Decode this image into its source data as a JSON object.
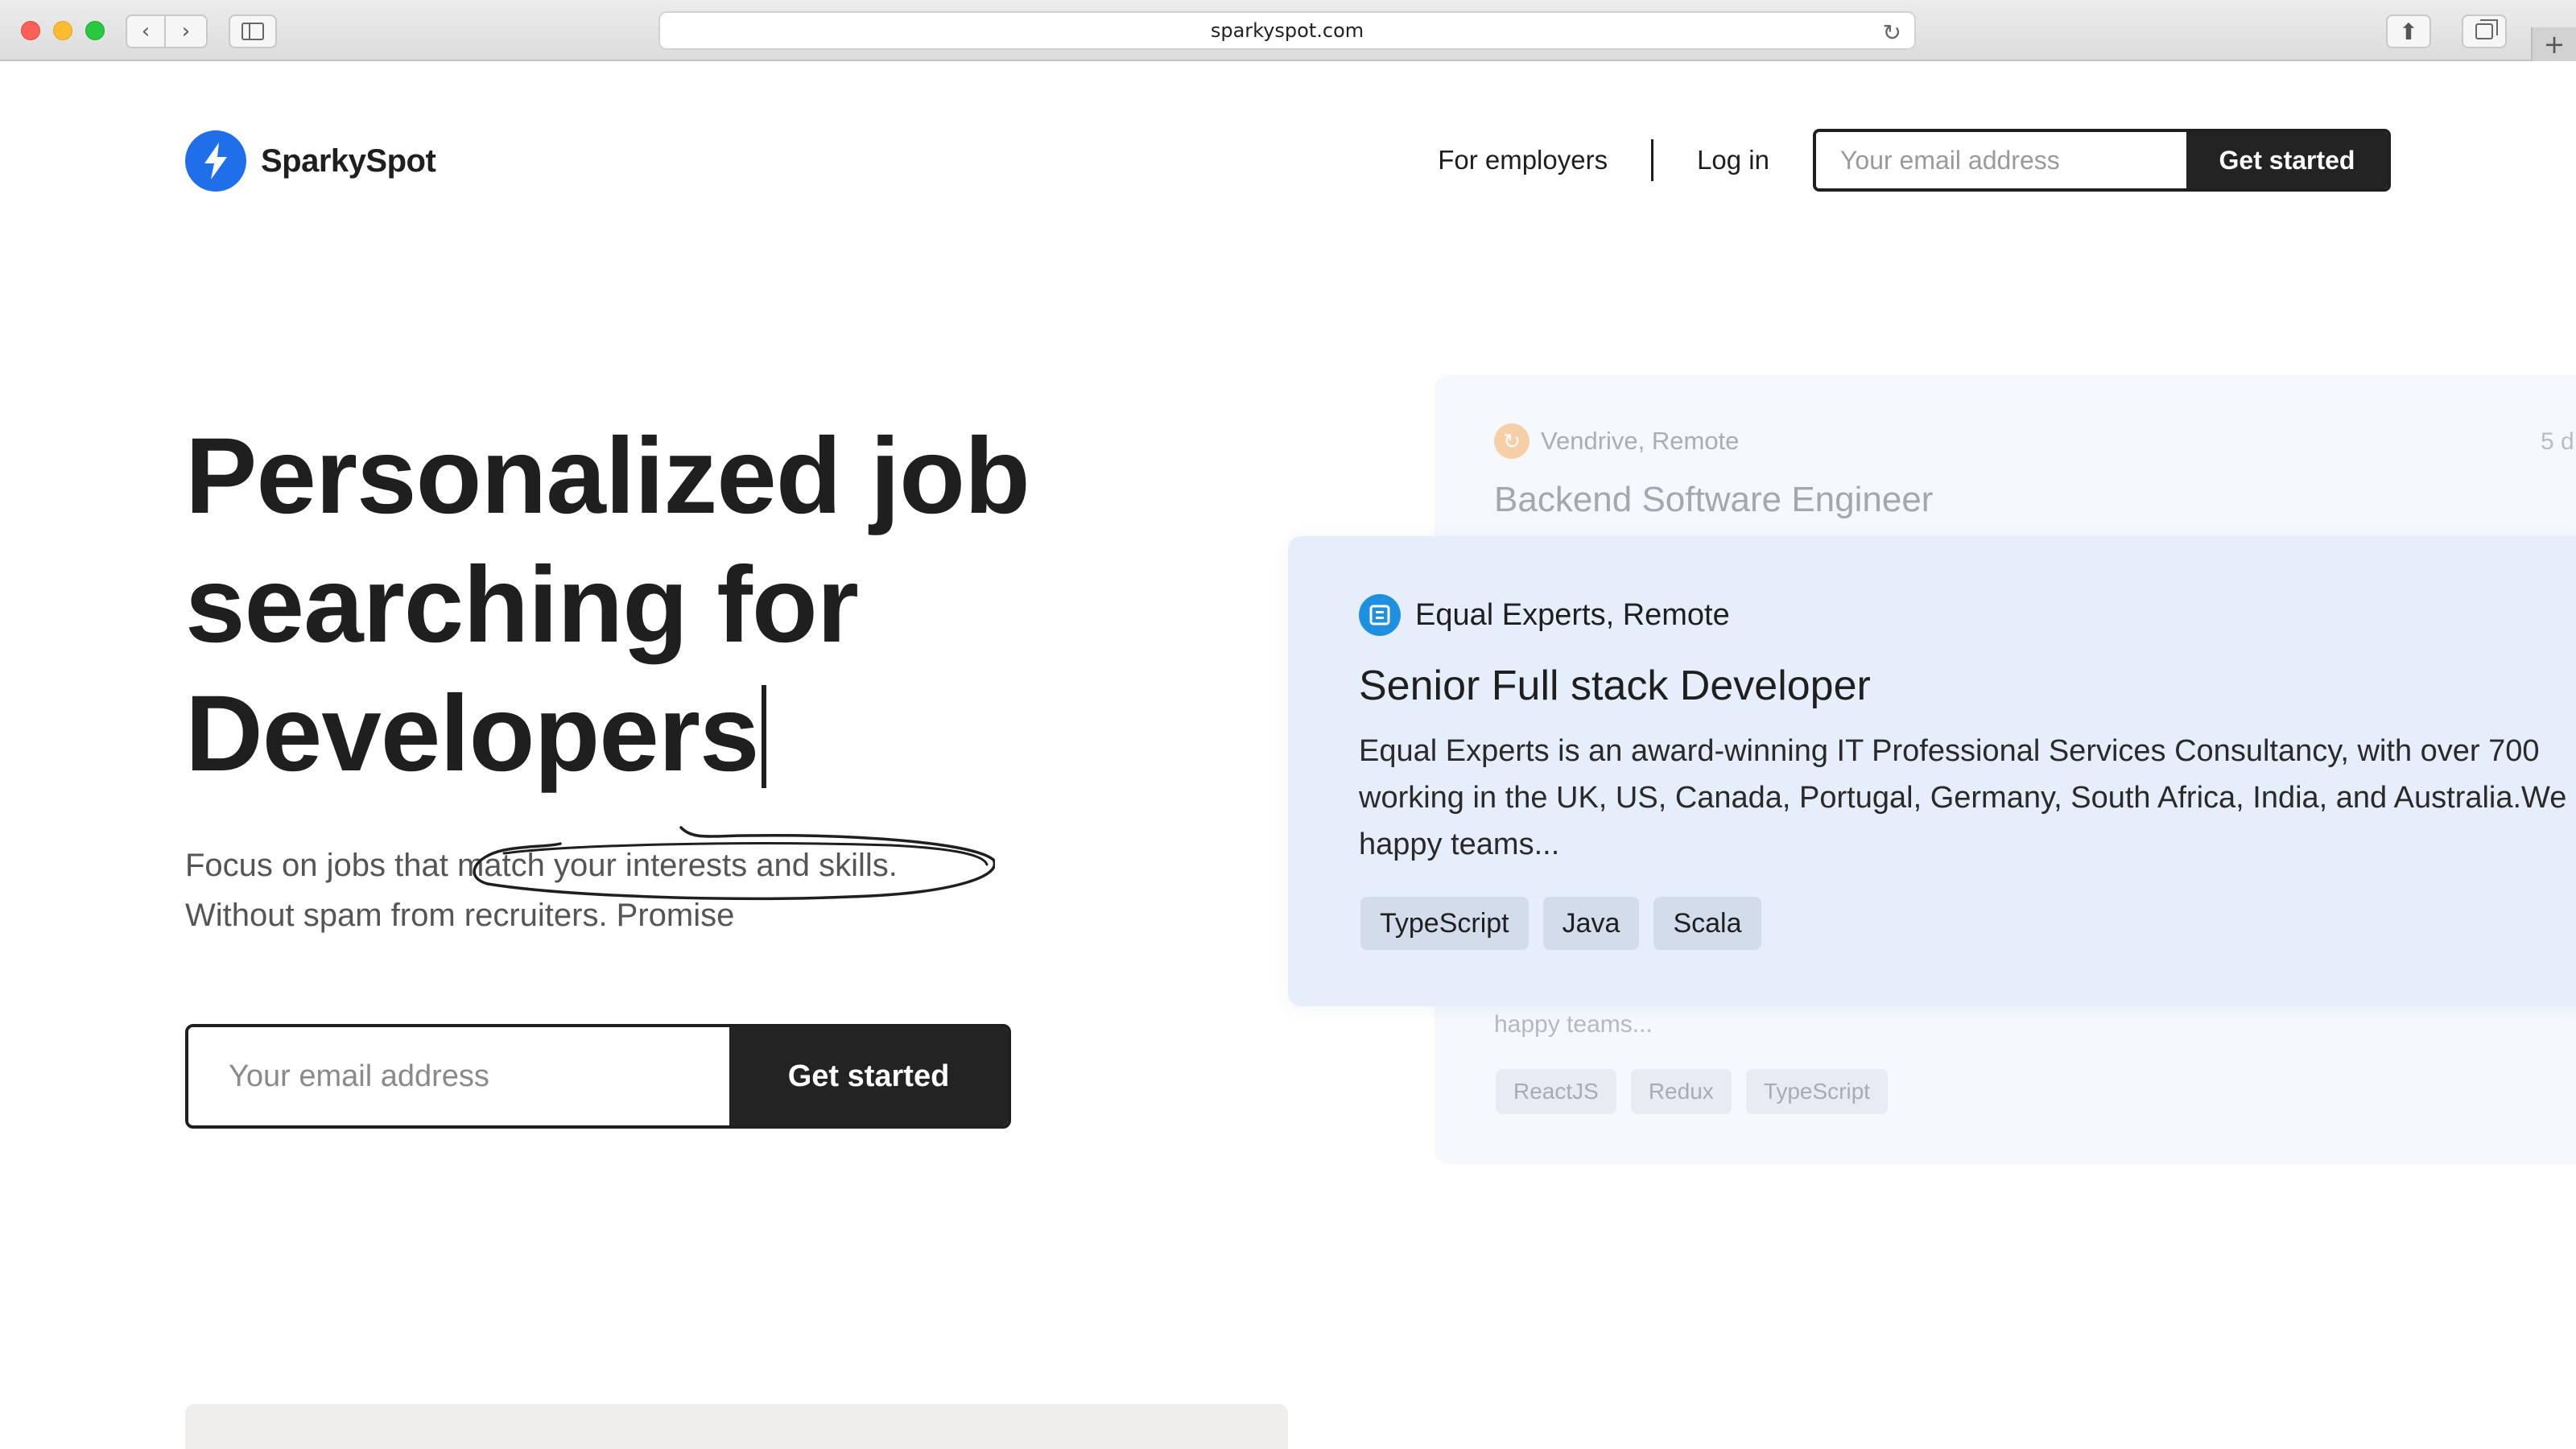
{
  "browser": {
    "url": "sparkyspot.com"
  },
  "header": {
    "brand": "SparkySpot",
    "nav": {
      "employers_link": "For employers",
      "login_link": "Log in"
    },
    "signup": {
      "email_placeholder": "Your email address",
      "cta_label": "Get started"
    }
  },
  "hero": {
    "title_line1": "Personalized job",
    "title_line2": "searching for",
    "title_line3": "Developers",
    "subtitle_pre": "Focus on jobs that ",
    "subtitle_highlight": "match your interests and skills.",
    "subtitle_line2": "Without spam from recruiters. Promise",
    "signup": {
      "email_placeholder": "Your email address",
      "cta_label": "Get started"
    }
  },
  "job_cards": {
    "back": {
      "company": "Vendrive, Remote",
      "posted": "5 d",
      "title": "Backend Software Engineer",
      "description_tail": "happy teams...",
      "tags": [
        "ReactJS",
        "Redux",
        "TypeScript"
      ]
    },
    "front": {
      "company": "Equal Experts, Remote",
      "title": "Senior Full stack Developer",
      "description_line1": "Equal Experts is an award-winning IT Professional Services Consultancy, with over 700",
      "description_line2": "working in the UK, US, Canada, Portugal, Germany, South Africa, India, and Australia.We",
      "description_line3": "happy teams...",
      "tags": [
        "TypeScript",
        "Java",
        "Scala"
      ]
    }
  },
  "colors": {
    "brand_blue": "#1f6feb",
    "dark": "#232323",
    "card_front_bg": "#e6eefb",
    "card_back_bg": "#f5f8fd"
  },
  "icons": {
    "brand": "lightning-bolt-icon",
    "back_company": "vendrive-logo-icon",
    "front_company": "equal-experts-logo-icon"
  }
}
